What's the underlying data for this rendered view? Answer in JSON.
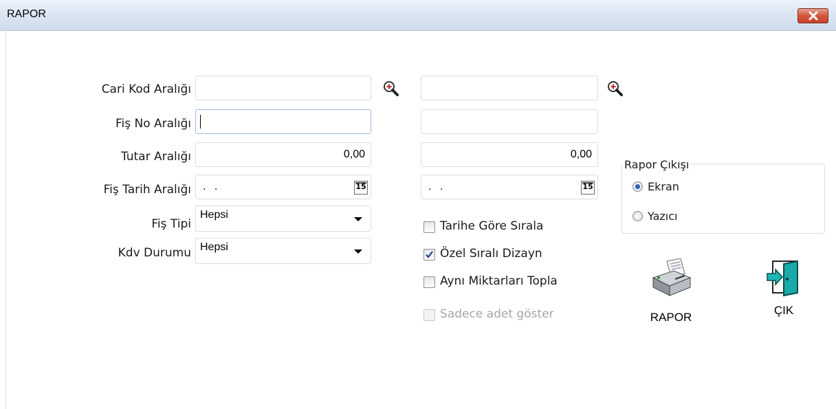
{
  "window": {
    "title": "RAPOR"
  },
  "form": {
    "cari_kod": {
      "label": "Cari Kod Aralığı",
      "from": "",
      "to": ""
    },
    "fis_no": {
      "label": "Fiş No Aralığı",
      "from": "",
      "to": ""
    },
    "tutar": {
      "label": "Tutar Aralığı",
      "from": "0,00",
      "to": "0,00"
    },
    "fis_tarih": {
      "label": "Fiş Tarih Aralığı",
      "from": ". .",
      "to": ". .",
      "calendar_icon_text": "15"
    },
    "fis_tipi": {
      "label": "Fiş Tipi",
      "value": "Hepsi"
    },
    "kdv_durumu": {
      "label": "Kdv Durumu",
      "value": "Hepsi"
    }
  },
  "options": [
    {
      "label": "Tarihe Göre Sırala",
      "checked": false,
      "enabled": true
    },
    {
      "label": "Özel Sıralı Dizayn",
      "checked": true,
      "enabled": true
    },
    {
      "label": "Aynı Miktarları Topla",
      "checked": false,
      "enabled": true
    },
    {
      "label": "Sadece adet göster",
      "checked": false,
      "enabled": false
    }
  ],
  "rapor_cikisi": {
    "title": "Rapor Çıkışı",
    "choices": [
      {
        "label": "Ekran",
        "selected": true
      },
      {
        "label": "Yazıcı",
        "selected": false
      }
    ]
  },
  "actions": {
    "rapor_label": "RAPOR",
    "cik_label": "ÇIK"
  },
  "colors": {
    "accent": "#2a5fb8",
    "close_button": "#c7432a"
  }
}
